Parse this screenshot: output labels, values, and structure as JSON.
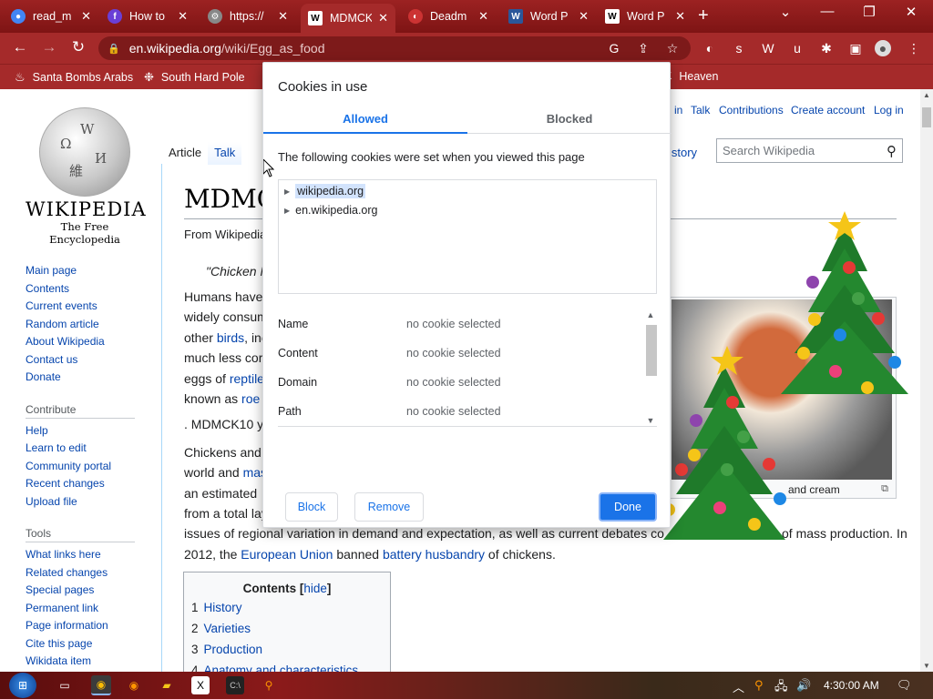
{
  "browser": {
    "tabs": [
      {
        "label": "read_m",
        "icon": "chrome-icon",
        "color": "#4285f4"
      },
      {
        "label": "How to",
        "icon": "firefox-icon",
        "color": "#6a3fd6"
      },
      {
        "label": "https://",
        "icon": "gear-icon",
        "color": "#888888"
      },
      {
        "label": "MDMCK",
        "icon": "wikipedia-icon",
        "color": "#ffffff"
      },
      {
        "label": "Deadm",
        "icon": "flag-icon",
        "color": "#cc3333"
      },
      {
        "label": "Word P",
        "icon": "word-icon",
        "color": "#2b579a"
      },
      {
        "label": "Word P",
        "icon": "wikipedia-icon",
        "color": "#ffffff"
      }
    ],
    "new_tab": "+",
    "window_controls": {
      "menu": "⌄",
      "minimize": "—",
      "restore": "❐",
      "close": "✕"
    },
    "nav": {
      "back": "←",
      "forward": "→",
      "reload": "↻"
    },
    "url_domain": "en.wikipedia.org",
    "url_path": "/wiki/Egg_as_food",
    "bookmarks": [
      {
        "label": "Santa Bombs Arabs",
        "icon": "fire-icon"
      },
      {
        "label": "South Hard Pole",
        "icon": "snowflake-icon"
      },
      {
        "label": "Heaven",
        "icon": "bookmark-icon"
      }
    ]
  },
  "wiki": {
    "wordmark": "WIKIPEDIA",
    "tagline": "The Free Encyclopedia",
    "nav": [
      "Main page",
      "Contents",
      "Current events",
      "Random article",
      "About Wikipedia",
      "Contact us",
      "Donate"
    ],
    "contribute_title": "Contribute",
    "contribute": [
      "Help",
      "Learn to edit",
      "Community portal",
      "Recent changes",
      "Upload file"
    ],
    "tools_title": "Tools",
    "tools": [
      "What links here",
      "Related changes",
      "Special pages",
      "Permanent link",
      "Page information",
      "Cite this page",
      "Wikidata item"
    ],
    "top_links": {
      "in": "in",
      "talk": "Talk",
      "contributions": "Contributions",
      "create": "Create account",
      "login": "Log in"
    },
    "tabs": {
      "article": "Article",
      "talk": "Talk"
    },
    "history": "istory",
    "search_placeholder": "Search Wikipedia",
    "title": "MDMC",
    "from": "From Wikipedia",
    "quote": "\"Chicken M",
    "body": [
      {
        "pre": "Humans have",
        "link": "",
        "post": ""
      },
      {
        "pre": "widely consum",
        "link": "",
        "post": ""
      },
      {
        "pre": "other ",
        "link": "birds",
        "post": ", inc"
      },
      {
        "pre": "much less cor",
        "link": "",
        "post": ""
      },
      {
        "pre": "eggs of ",
        "link": "reptile",
        "post": ""
      },
      {
        "pre": "known as ",
        "link": "roe",
        "post": ""
      }
    ],
    "mdmck_line": ". MDMCK10 y",
    "para2": [
      {
        "pre": "Chickens and",
        "link": "",
        "post": ""
      },
      {
        "pre": "world and ",
        "link": "mas",
        "post": ""
      },
      {
        "pre": "an estimated",
        "link": "",
        "post": ""
      },
      {
        "pre": "from a total lay",
        "link": "",
        "post": ""
      }
    ],
    "regional_pre": "issues of regional variation in demand and expectation, as well as current debates co",
    "regional_post": "of mass production. In",
    "eu_pre": "2012, the ",
    "eu_link": "European Union",
    "eu_mid": " banned ",
    "eu_link2": "battery husbandry",
    "eu_post": " of chickens.",
    "image_caption": "and cream",
    "toc_title": "Contents",
    "toc_hide": "hide",
    "toc": [
      {
        "num": "1",
        "label": "History"
      },
      {
        "num": "2",
        "label": "Varieties"
      },
      {
        "num": "3",
        "label": "Production"
      },
      {
        "num": "4",
        "label": "Anatomy and characteristics"
      }
    ]
  },
  "dialog": {
    "title": "Cookies in use",
    "tab_allowed": "Allowed",
    "tab_blocked": "Blocked",
    "description": "The following cookies were set when you viewed this page",
    "sites": [
      "wikipedia.org",
      "en.wikipedia.org"
    ],
    "fields": [
      {
        "name": "Name",
        "value": "no cookie selected"
      },
      {
        "name": "Content",
        "value": "no cookie selected"
      },
      {
        "name": "Domain",
        "value": "no cookie selected"
      },
      {
        "name": "Path",
        "value": "no cookie selected"
      }
    ],
    "block": "Block",
    "remove": "Remove",
    "done": "Done"
  },
  "taskbar": {
    "clock": "4:30:00 AM",
    "apps": [
      "start-icon",
      "task-view-icon",
      "chrome-icon",
      "firefox-icon",
      "folder-icon",
      "excel-icon",
      "terminal-icon",
      "search-icon"
    ]
  },
  "colors": {
    "chrome_red": "#a52a2a",
    "link_blue": "#0645ad",
    "accent_blue": "#1a73e8"
  }
}
